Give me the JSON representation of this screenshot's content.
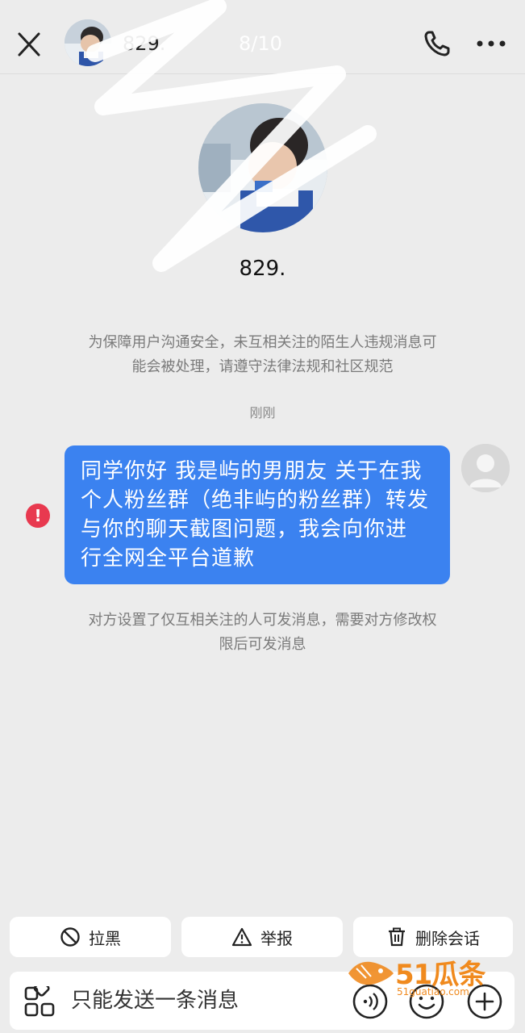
{
  "header": {
    "name": "829.",
    "counter": "8/10",
    "close_icon": "close-icon",
    "phone_icon": "phone-icon",
    "more_icon": "more-icon"
  },
  "profile": {
    "name": "829."
  },
  "notice": {
    "line1": "为保障用户沟通安全，未互相关注的陌生人违规消息可",
    "line2": "能会被处理，请遵守法律法规和社区规范"
  },
  "time_label": "刚刚",
  "message": {
    "line1": "同学你好 我是屿的男朋友 关于在我",
    "line2": "个人粉丝群（绝非屿的粉丝群）转发",
    "line3": "与你的聊天截图问题，我会向你进",
    "line4": "行全网全平台道歉",
    "status_icon": "error-icon",
    "status_glyph": "!"
  },
  "restriction": {
    "line1": "对方设置了仅互相关注的人可发消息，需要对方修改权",
    "line2": "限后可发消息"
  },
  "actions": {
    "block_label": "拉黑",
    "report_label": "举报",
    "delete_label": "删除会话"
  },
  "input": {
    "placeholder": "只能发送一条消息"
  },
  "watermark": {
    "brand": "51瓜条",
    "sub": "51guatiao.com"
  },
  "colors": {
    "bubble": "#3b82f0",
    "background": "#ececec",
    "error": "#e8394f",
    "watermark": "#f08a1e"
  }
}
